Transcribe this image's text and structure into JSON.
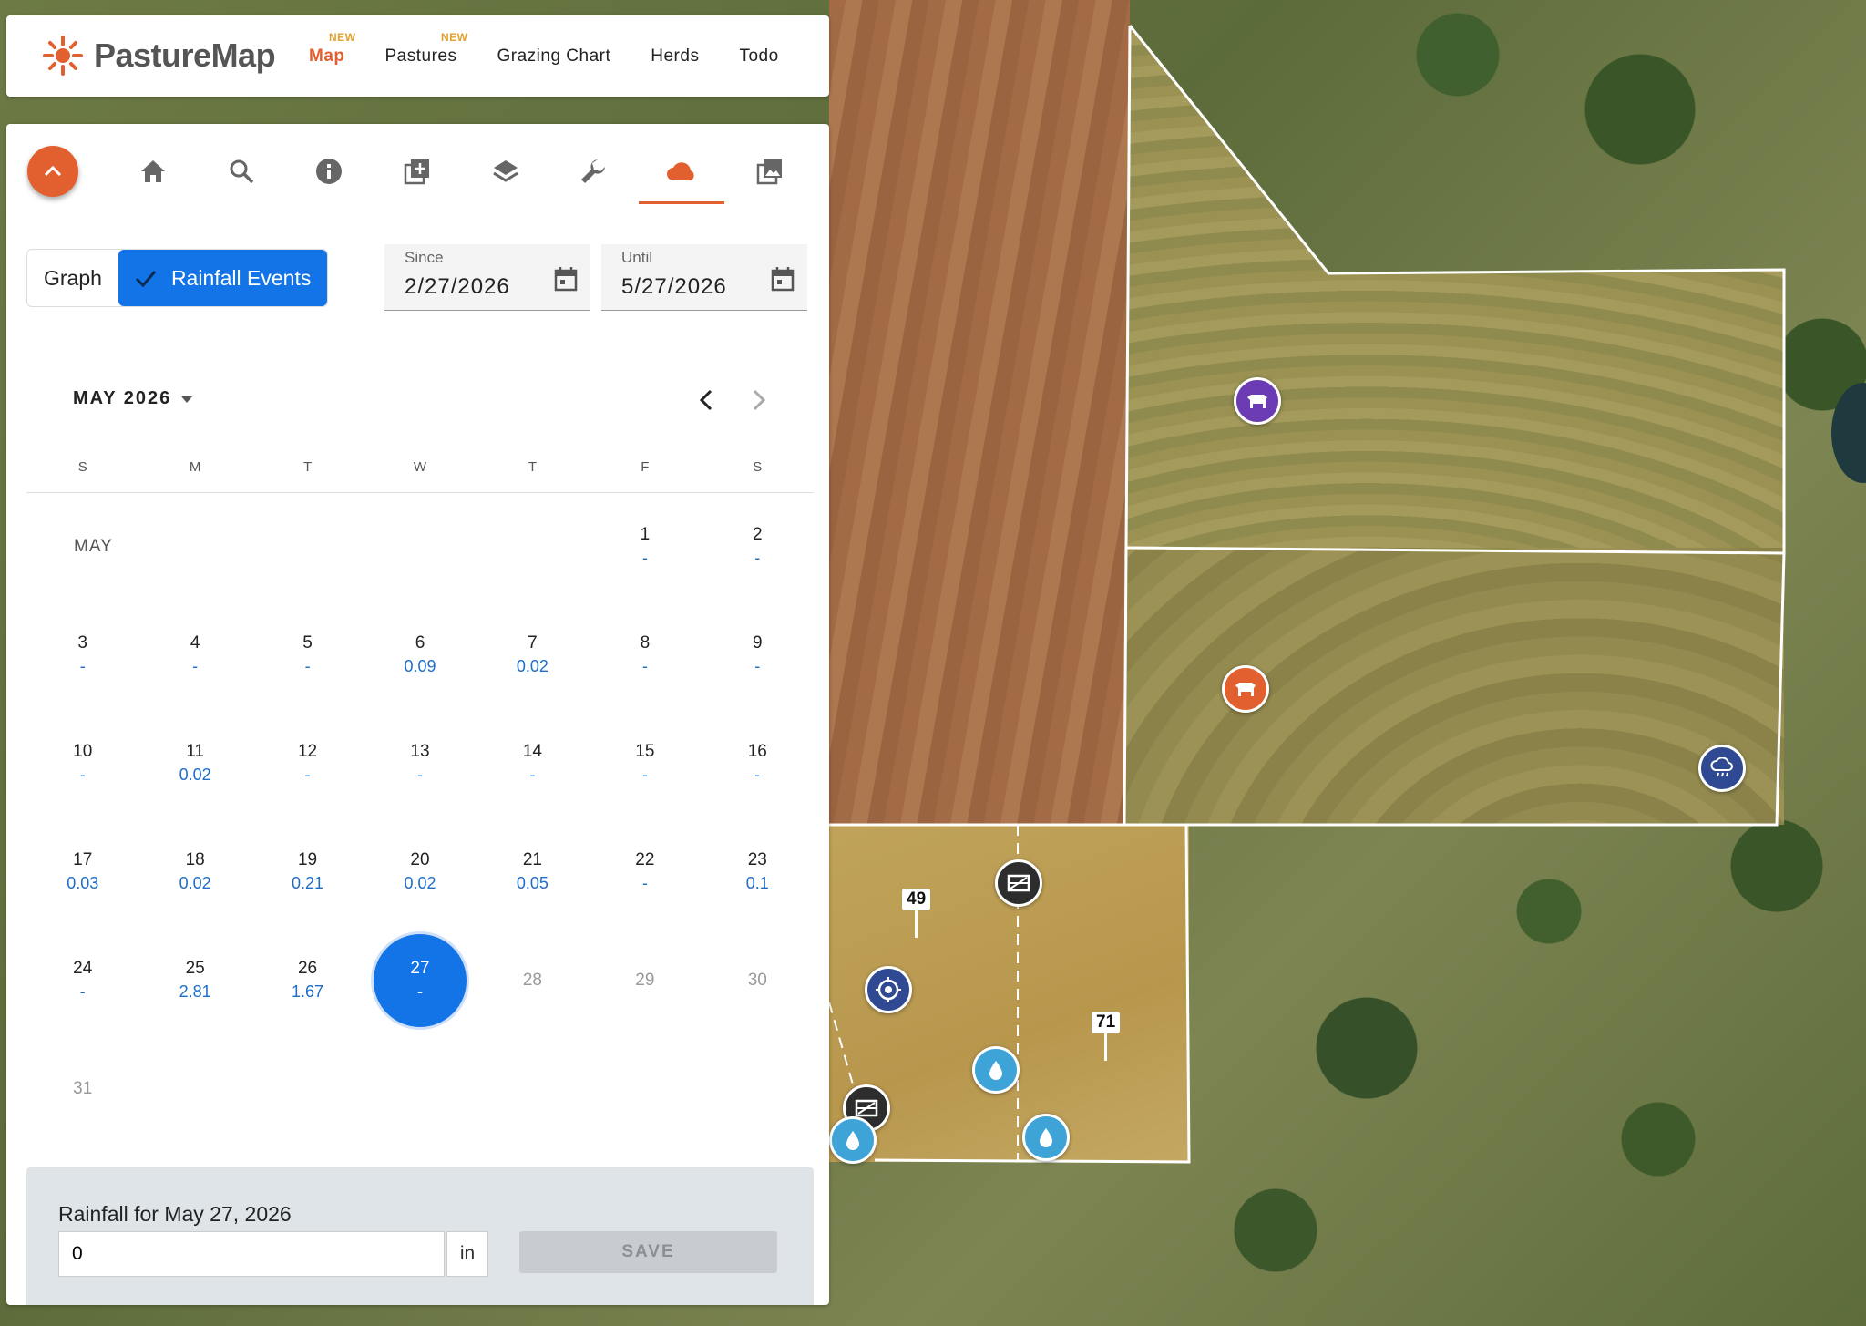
{
  "app": {
    "name": "PastureMap"
  },
  "nav": {
    "items": [
      {
        "label": "Map",
        "badge": "NEW",
        "active": true
      },
      {
        "label": "Pastures",
        "badge": "NEW",
        "active": false
      },
      {
        "label": "Grazing Chart",
        "badge": "",
        "active": false
      },
      {
        "label": "Herds",
        "badge": "",
        "active": false
      },
      {
        "label": "Todo",
        "badge": "",
        "active": false
      }
    ]
  },
  "toolbar": {
    "tools": [
      "home-icon",
      "search-icon",
      "info-icon",
      "add-layer-icon",
      "layers-icon",
      "wrench-icon",
      "cloud-icon",
      "photo-icon"
    ],
    "active_tool": "cloud-icon"
  },
  "view_toggle": {
    "graph_label": "Graph",
    "events_label": "Rainfall Events",
    "selected": "Rainfall Events"
  },
  "since": {
    "label": "Since",
    "value": "2/27/2026"
  },
  "until": {
    "label": "Until",
    "value": "5/27/2026"
  },
  "calendar": {
    "month_title": "MAY 2026",
    "month_short": "MAY",
    "weekdays": [
      "S",
      "M",
      "T",
      "W",
      "T",
      "F",
      "S"
    ],
    "days": [
      {
        "d": "1",
        "v": "-"
      },
      {
        "d": "2",
        "v": "-"
      },
      {
        "d": "3",
        "v": "-"
      },
      {
        "d": "4",
        "v": "-"
      },
      {
        "d": "5",
        "v": "-"
      },
      {
        "d": "6",
        "v": "0.09"
      },
      {
        "d": "7",
        "v": "0.02"
      },
      {
        "d": "8",
        "v": "-"
      },
      {
        "d": "9",
        "v": "-"
      },
      {
        "d": "10",
        "v": "-"
      },
      {
        "d": "11",
        "v": "0.02"
      },
      {
        "d": "12",
        "v": "-"
      },
      {
        "d": "13",
        "v": "-"
      },
      {
        "d": "14",
        "v": "-"
      },
      {
        "d": "15",
        "v": "-"
      },
      {
        "d": "16",
        "v": "-"
      },
      {
        "d": "17",
        "v": "0.03"
      },
      {
        "d": "18",
        "v": "0.02"
      },
      {
        "d": "19",
        "v": "0.21"
      },
      {
        "d": "20",
        "v": "0.02"
      },
      {
        "d": "21",
        "v": "0.05"
      },
      {
        "d": "22",
        "v": "-"
      },
      {
        "d": "23",
        "v": "0.1"
      },
      {
        "d": "24",
        "v": "-"
      },
      {
        "d": "25",
        "v": "2.81"
      },
      {
        "d": "26",
        "v": "1.67"
      },
      {
        "d": "27",
        "v": "-"
      },
      {
        "d": "28",
        "v": ""
      },
      {
        "d": "29",
        "v": ""
      },
      {
        "d": "30",
        "v": ""
      },
      {
        "d": "31",
        "v": ""
      }
    ],
    "selected_day": "27"
  },
  "rainfall": {
    "title": "Rainfall for May 27, 2026",
    "value": "0",
    "unit": "in",
    "save_label": "SAVE"
  },
  "map_pins": {
    "a": "49",
    "b": "71"
  },
  "colors": {
    "accent": "#e2602f",
    "primary": "#1274e6",
    "value_blue": "#1e6ec9"
  }
}
